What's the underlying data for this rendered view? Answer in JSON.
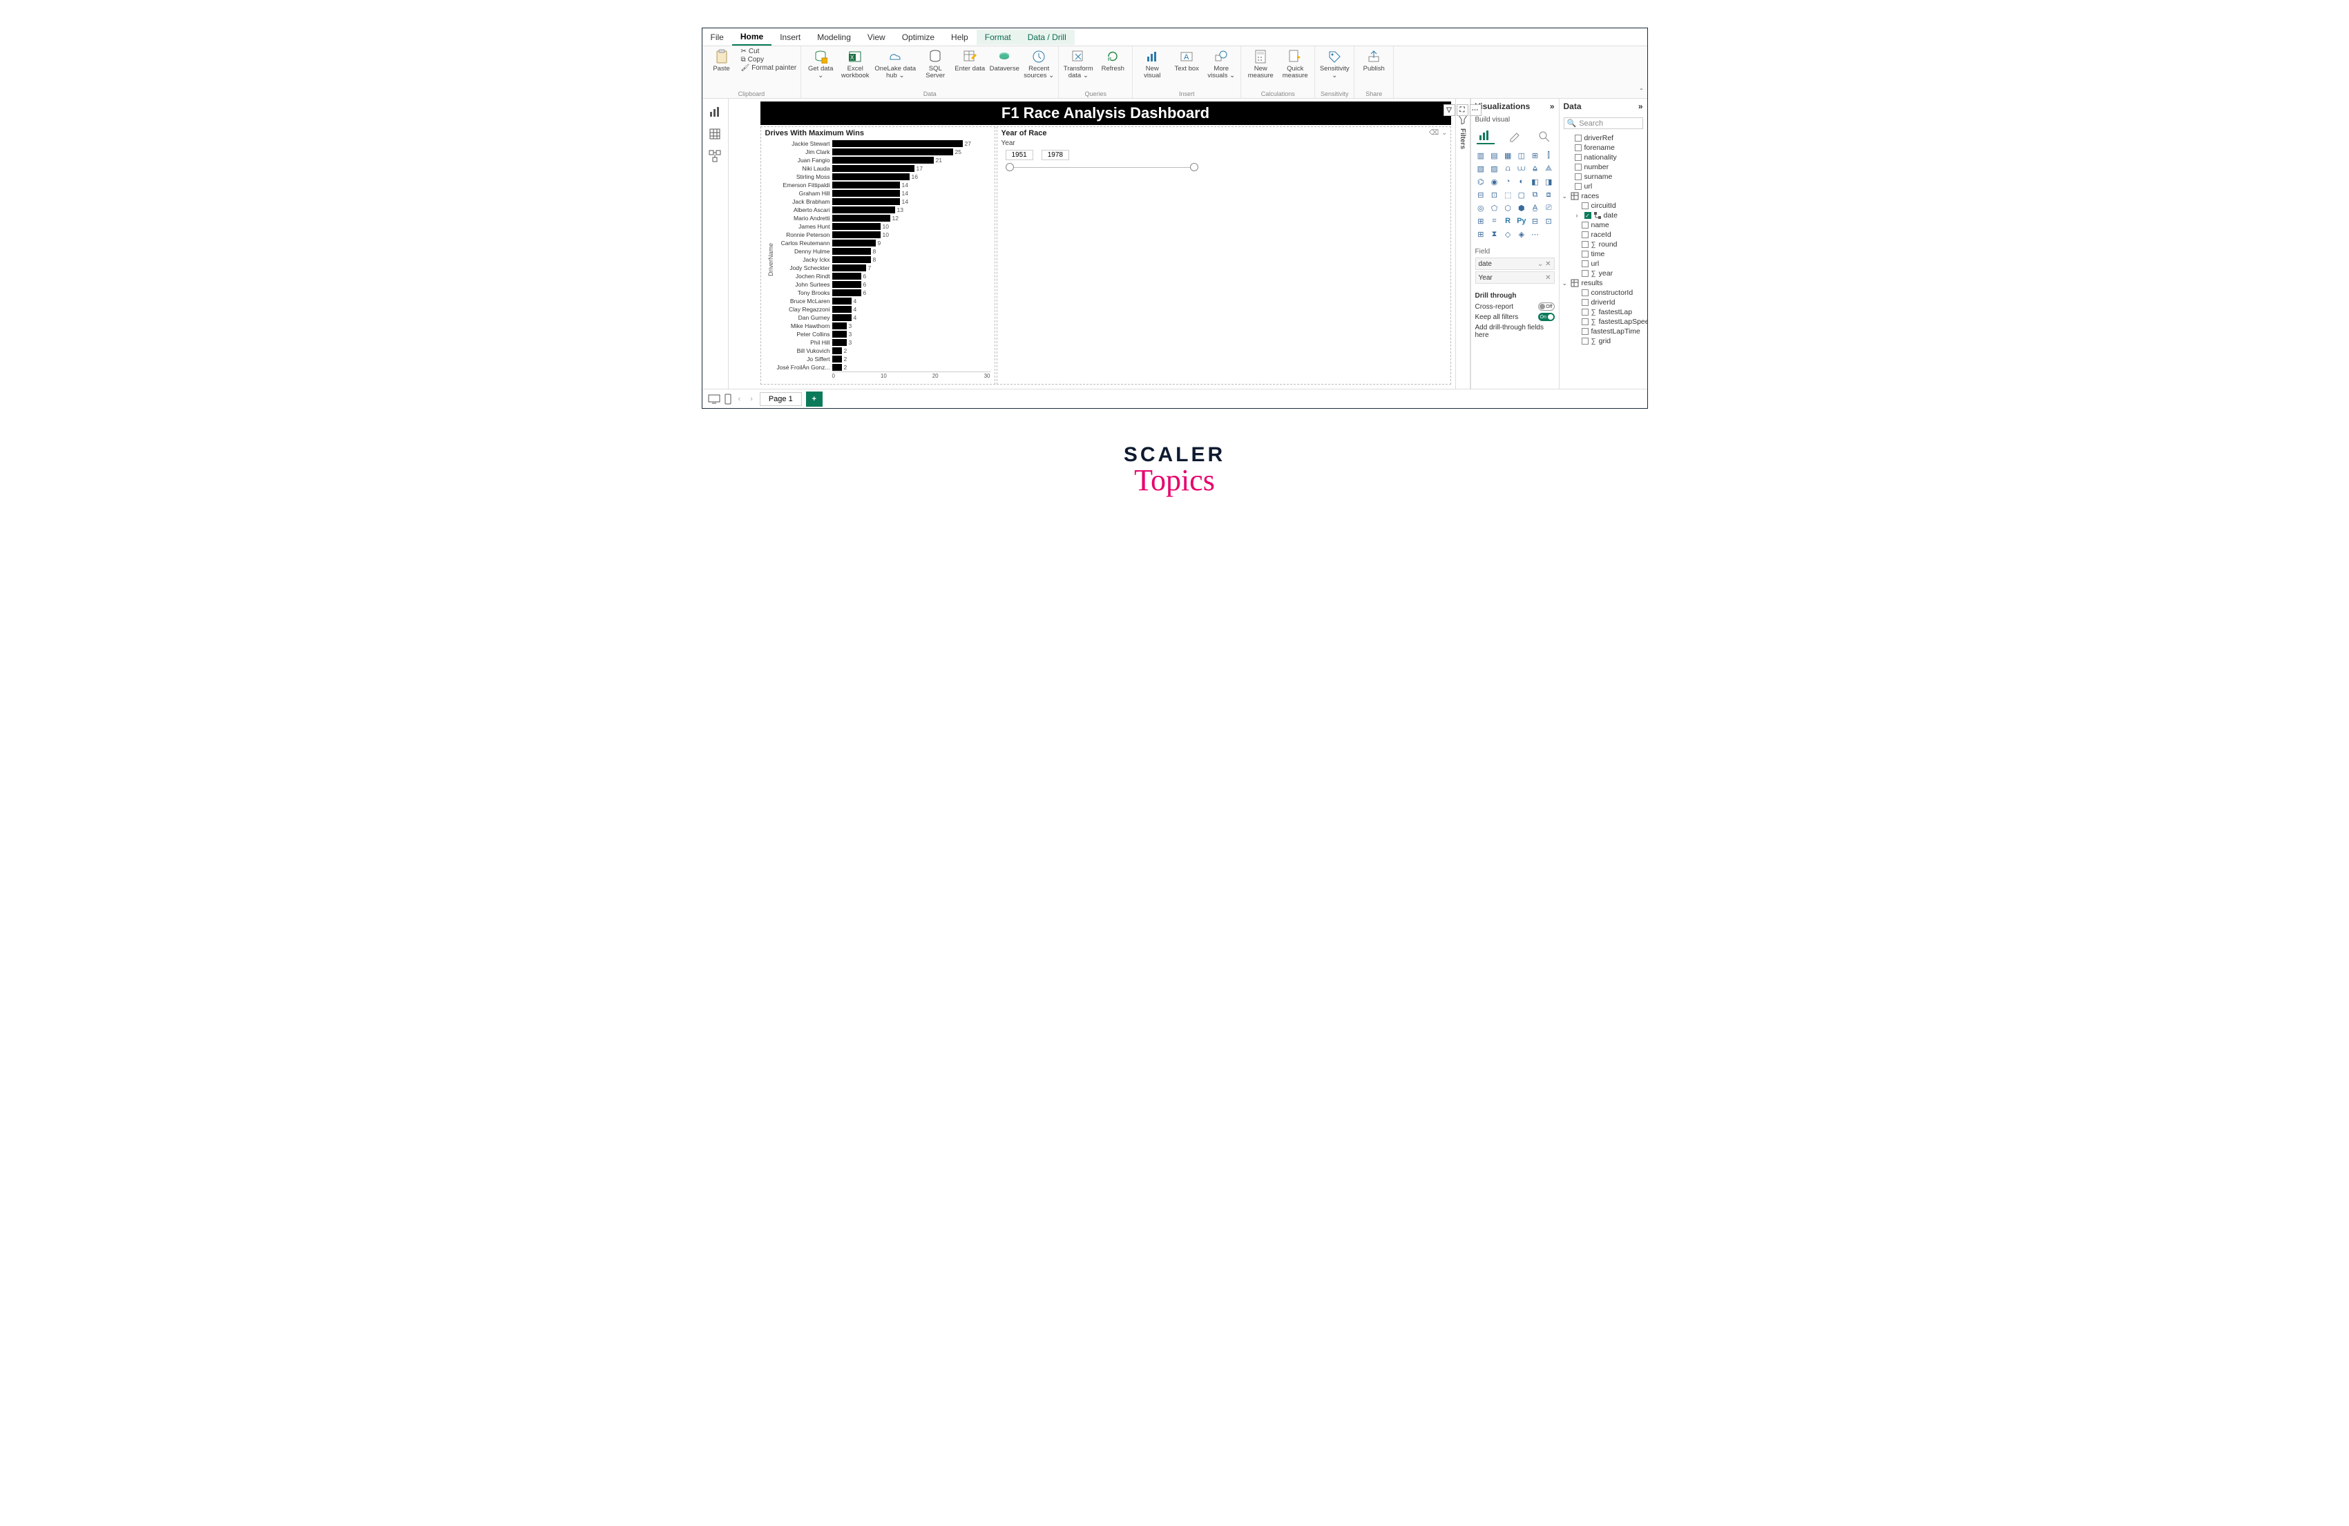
{
  "menu": {
    "file": "File",
    "home": "Home",
    "insert": "Insert",
    "modeling": "Modeling",
    "view": "View",
    "optimize": "Optimize",
    "help": "Help",
    "format": "Format",
    "datadrill": "Data / Drill"
  },
  "ribbon": {
    "clipboard": {
      "label": "Clipboard",
      "paste": "Paste",
      "cut": "Cut",
      "copy": "Copy",
      "format_painter": "Format painter"
    },
    "data": {
      "label": "Data",
      "get_data": "Get data ⌄",
      "excel": "Excel workbook",
      "onelake": "OneLake data hub ⌄",
      "sql": "SQL Server",
      "enter": "Enter data",
      "dataverse": "Dataverse",
      "recent": "Recent sources ⌄"
    },
    "queries": {
      "label": "Queries",
      "transform": "Transform data ⌄",
      "refresh": "Refresh"
    },
    "insert": {
      "label": "Insert",
      "new_visual": "New visual",
      "text_box": "Text box",
      "more_visuals": "More visuals ⌄"
    },
    "calculations": {
      "label": "Calculations",
      "new_measure": "New measure",
      "quick_measure": "Quick measure"
    },
    "sensitivity": {
      "label": "Sensitivity",
      "btn": "Sensitivity ⌄"
    },
    "share": {
      "label": "Share",
      "publish": "Publish"
    }
  },
  "dashboard": {
    "title": "F1 Race Analysis Dashboard",
    "bar_title": "Drives With Maximum Wins",
    "bar_y_axis": "DriverName",
    "slicer_title": "Year of Race",
    "slicer_field": "Year",
    "slicer_min": "1951",
    "slicer_max": "1978",
    "x_ticks": [
      "0",
      "10",
      "20",
      "30"
    ]
  },
  "viz_pane": {
    "header": "Visualizations",
    "sub": "Build visual",
    "field_label": "Field",
    "field1": "date",
    "field2": "Year",
    "drill_header": "Drill through",
    "cross_report": "Cross-report",
    "cross_report_state": "Off",
    "keep_filters": "Keep all filters",
    "keep_filters_state": "On",
    "drill_placeholder": "Add drill-through fields here"
  },
  "data_pane": {
    "header": "Data",
    "search": "Search",
    "groups": {
      "anon": [
        "driverRef",
        "forename",
        "nationality",
        "number",
        "surname",
        "url"
      ],
      "races": {
        "name": "races",
        "fields": [
          {
            "n": "circuitId"
          },
          {
            "n": "date",
            "checked": true,
            "nested": true
          },
          {
            "n": "name"
          },
          {
            "n": "raceId"
          },
          {
            "n": "round",
            "sigma": true
          },
          {
            "n": "time"
          },
          {
            "n": "url"
          },
          {
            "n": "year",
            "sigma": true
          }
        ]
      },
      "results": {
        "name": "results",
        "fields": [
          {
            "n": "constructorId"
          },
          {
            "n": "driverId"
          },
          {
            "n": "fastestLap",
            "sigma": true
          },
          {
            "n": "fastestLapSpeed",
            "sigma": true
          },
          {
            "n": "fastestLapTime"
          },
          {
            "n": "grid",
            "sigma": true
          }
        ]
      }
    }
  },
  "filters_label": "Filters",
  "footer": {
    "page": "Page 1"
  },
  "brand": {
    "line1": "SCALER",
    "line2": "Topics"
  },
  "chart_data": {
    "type": "bar",
    "orientation": "horizontal",
    "title": "Drives With Maximum Wins",
    "ylabel": "DriverName",
    "xlabel": "",
    "xlim": [
      0,
      30
    ],
    "categories": [
      "Jackie Stewart",
      "Jim Clark",
      "Juan Fangio",
      "Niki Lauda",
      "Stirling Moss",
      "Emerson Fittipaldi",
      "Graham Hill",
      "Jack Brabham",
      "Alberto Ascari",
      "Mario Andretti",
      "James Hunt",
      "Ronnie Peterson",
      "Carlos Reutemann",
      "Denny Hulme",
      "Jacky Ickx",
      "Jody Scheckter",
      "Jochen Rindt",
      "John Surtees",
      "Tony Brooks",
      "Bruce McLaren",
      "Clay Regazzoni",
      "Dan Gurney",
      "Mike Hawthorn",
      "Peter Collins",
      "Phil Hill",
      "Bill Vukovich",
      "Jo Siffert",
      "José FroilÁn Gonz..."
    ],
    "values": [
      27,
      25,
      21,
      17,
      16,
      14,
      14,
      14,
      13,
      12,
      10,
      10,
      9,
      8,
      8,
      7,
      6,
      6,
      6,
      4,
      4,
      4,
      3,
      3,
      3,
      2,
      2,
      2
    ]
  }
}
